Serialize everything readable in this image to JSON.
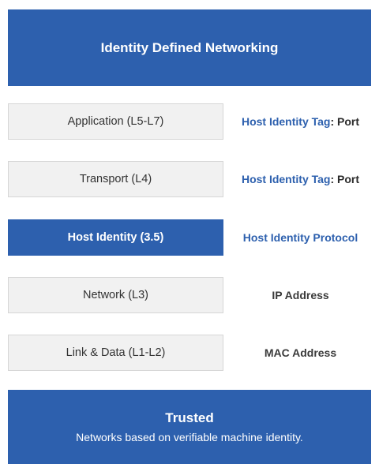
{
  "header": {
    "title": "Identity Defined Networking"
  },
  "layers": [
    {
      "label": "Application (L5-L7)",
      "identifier": "Host Identity Tag",
      "identifier_suffix": ": Port"
    },
    {
      "label": "Transport (L4)",
      "identifier": "Host Identity Tag",
      "identifier_suffix": ": Port"
    },
    {
      "label": "Host Identity (3.5)",
      "identifier": "Host Identity Protocol",
      "identifier_suffix": ""
    },
    {
      "label": "Network (L3)",
      "identifier": "IP Address",
      "identifier_suffix": ""
    },
    {
      "label": "Link & Data (L1-L2)",
      "identifier": "MAC Address",
      "identifier_suffix": ""
    }
  ],
  "footer": {
    "title": "Trusted",
    "subtitle": "Networks based on verifiable machine identity."
  },
  "colors": {
    "accent": "#2d60ae",
    "layer_background": "#f1f1f1",
    "layer_border": "#d6d6d6"
  }
}
